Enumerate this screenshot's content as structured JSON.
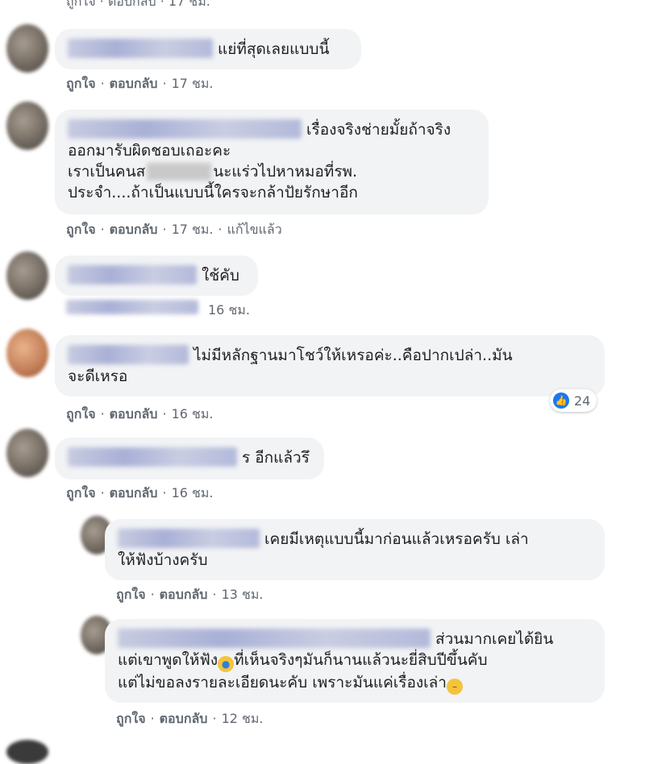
{
  "comments": [
    {
      "text_partial_top": "ถูกใจ · ตอบกลับ · 17 ชม."
    },
    {
      "text": "แย่ที่สุดเลยแบบนี้",
      "actions": {
        "like": "ถูกใจ",
        "reply": "ตอบกลับ",
        "time": "17 ชม."
      }
    },
    {
      "text_line1_tail": "เรื่องจริงช่ายมั้ยถ้าจริง",
      "text_line2": "ออกมารับผิดชอบเถอะคะ",
      "text_line3_a": "เราเป็นคนส",
      "text_line3_b": "นะแร่วไปหาหมอที่รพ.",
      "text_line4": "ประจำ....ถ้าเป็นแบบนี้ใครจะกล้าปัยรักษาอีก",
      "actions": {
        "like": "ถูกใจ",
        "reply": "ตอบกลับ",
        "time": "17 ชม.",
        "edited": "แก้ไขแล้ว"
      }
    },
    {
      "text": "ใช้คับ",
      "actions": {
        "time": "16 ชม."
      }
    },
    {
      "text_line1": "ไม่มีหลักฐานมาโชว์ให้เหรอค่ะ..คือปากเปล่า..มัน",
      "text_line2": "จะดีเหรอ",
      "reaction_count": "24",
      "actions": {
        "like": "ถูกใจ",
        "reply": "ตอบกลับ",
        "time": "16 ชม."
      }
    },
    {
      "text": "ร อีกแล้วรึ",
      "actions": {
        "like": "ถูกใจ",
        "reply": "ตอบกลับ",
        "time": "16 ชม."
      }
    }
  ],
  "replies": [
    {
      "text_line1": "เคยมีเหตุแบบนี้มาก่อนแล้วเหรอครับ เล่า",
      "text_line2": "ให้ฟังบ้างครับ",
      "actions": {
        "like": "ถูกใจ",
        "reply": "ตอบกลับ",
        "time": "13 ชม."
      }
    },
    {
      "text_line1": "ส่วนมากเคยได้ยิน",
      "text_line2_a": "แต่เขาพูดให้ฟัง",
      "text_line2_b": "ที่เห็นจริงๆมันก็นานแล้วนะยี่สิบปีขึ้นคับ",
      "text_line3": "แต่ไม่ขอลงรายละเอียดนะคับ เพราะมันแค่เรื่องเล่า",
      "actions": {
        "like": "ถูกใจ",
        "reply": "ตอบกลับ",
        "time": "12 ชม."
      }
    }
  ],
  "colors": {
    "bubble": "#f2f3f5",
    "meta_text": "#606770",
    "like_blue": "#1877f2"
  }
}
